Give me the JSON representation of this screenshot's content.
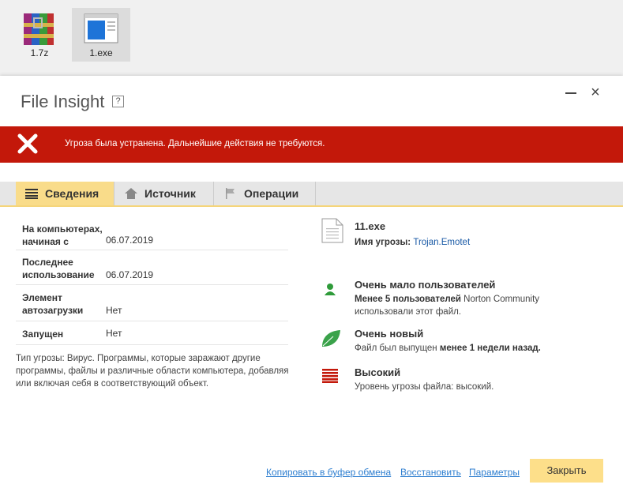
{
  "desktop": {
    "icons": [
      {
        "label": "1.7z",
        "icon": "winrar-archive-icon"
      },
      {
        "label": "1.exe",
        "icon": "exe-file-icon"
      }
    ]
  },
  "dialog": {
    "title": "File Insight",
    "help": "?",
    "banner": "Угроза была устранена. Дальнейшие действия не требуются.",
    "tabs": [
      {
        "label": "Сведения",
        "icon": "list-icon"
      },
      {
        "label": "Источник",
        "icon": "home-icon"
      },
      {
        "label": "Операции",
        "icon": "flag-icon"
      }
    ],
    "details": [
      {
        "key": "На компьютерах, начиная с",
        "value": "06.07.2019"
      },
      {
        "key": "Последнее использование",
        "value": "06.07.2019"
      },
      {
        "key": "Элемент автозагрузки",
        "value": "Нет"
      },
      {
        "key": "Запущен",
        "value": "Нет"
      }
    ],
    "description": "Тип угрозы: Вирус. Программы, которые заражают другие программы, файлы и различные области компьютера, добавляя или включая себя в соответствующий объект.",
    "file": {
      "name": "11.exe",
      "threat_label": "Имя угрозы:",
      "threat_name": "Trojan.Emotet"
    },
    "users": {
      "title": "Очень мало пользователей",
      "bold": "Менее 5 пользователей",
      "text": " Norton Community",
      "text2": "использовали этот файл."
    },
    "age": {
      "title": "Очень новый",
      "text": "Файл был выпущен ",
      "bold": "менее 1 недели назад."
    },
    "risk": {
      "title": "Высокий",
      "text": "Уровень угрозы файла: высокий."
    },
    "footer": {
      "copy": "Копировать в буфер обмена",
      "restore": "Восстановить",
      "params": "Параметры",
      "close": "Закрыть"
    }
  },
  "colors": {
    "banner": "#c3180a",
    "tab_active": "#f9dc8a",
    "button": "#fddf8a",
    "link": "#2f7fd0",
    "green": "#2f9b3a"
  }
}
